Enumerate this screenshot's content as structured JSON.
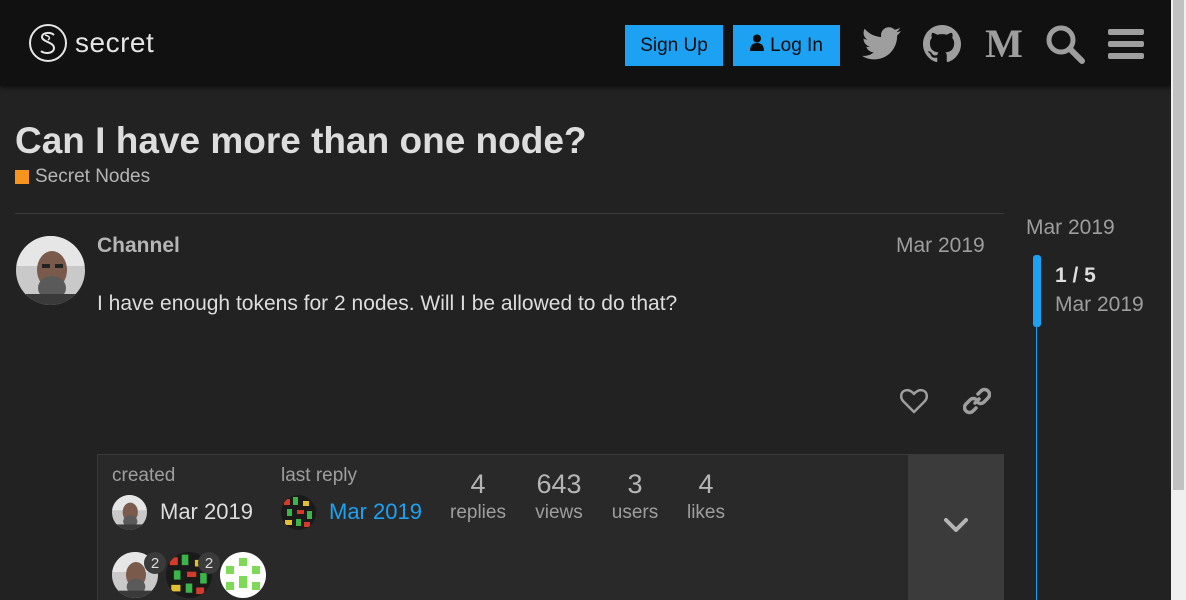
{
  "header": {
    "logo_text": "secret",
    "signup_label": "Sign Up",
    "login_label": "Log In",
    "icons": [
      "twitter-icon",
      "github-icon",
      "medium-icon",
      "search-icon",
      "hamburger-menu-icon"
    ]
  },
  "topic": {
    "title": "Can I have more than one node?",
    "category": "Secret Nodes",
    "category_color": "#f7941d"
  },
  "post": {
    "username": "Channel",
    "date": "Mar 2019",
    "body": "I have enough tokens for 2 nodes. Will I be allowed to do that?"
  },
  "topic_map": {
    "created_label": "created",
    "created_date": "Mar 2019",
    "last_reply_label": "last reply",
    "last_reply_date": "Mar 2019",
    "stats": [
      {
        "value": "4",
        "label": "replies"
      },
      {
        "value": "643",
        "label": "views"
      },
      {
        "value": "3",
        "label": "users"
      },
      {
        "value": "4",
        "label": "likes"
      }
    ],
    "participants": [
      {
        "count": "2"
      },
      {
        "count": "2"
      },
      {
        "count": ""
      }
    ]
  },
  "timeline": {
    "top_date": "Mar 2019",
    "position": "1 / 5",
    "current_date": "Mar 2019"
  },
  "colors": {
    "accent": "#1da1f2",
    "background": "#222222",
    "header": "#111111"
  }
}
